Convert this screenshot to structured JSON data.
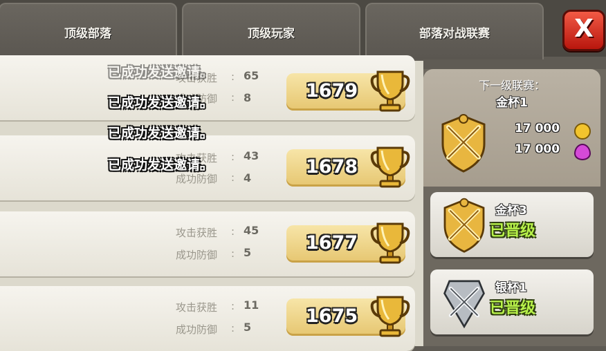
{
  "tabs": [
    "顶级部落",
    "顶级玩家",
    "部落对战联赛"
  ],
  "close_label": "X",
  "stat_labels": {
    "attack": "攻击获胜",
    "defense": "成功防御",
    "colon": ":"
  },
  "players": [
    {
      "attack_wins": "65",
      "defense_wins": "8",
      "trophies": "1679"
    },
    {
      "attack_wins": "43",
      "defense_wins": "4",
      "trophies": "1678"
    },
    {
      "attack_wins": "45",
      "defense_wins": "5",
      "trophies": "1677"
    },
    {
      "attack_wins": "11",
      "defense_wins": "5",
      "trophies": "1675"
    }
  ],
  "toasts": [
    "已成功发送邀请。",
    "已成功发送邀请。",
    "已成功发送邀请。",
    "已成功发送邀请。"
  ],
  "next_league": {
    "title": "下一级联赛：",
    "name": "金杯1",
    "gold_reward": "17 000",
    "elixir_reward": "17 000"
  },
  "leagues": [
    {
      "name": "金杯3",
      "status": "已晋级",
      "tier": "gold"
    },
    {
      "name": "银杯1",
      "status": "已晋级",
      "tier": "silver"
    }
  ],
  "colors": {
    "gold": "#e8b640",
    "silver": "#b7bcc2",
    "promoted": "#b8f24a",
    "close": "#d9261a"
  }
}
